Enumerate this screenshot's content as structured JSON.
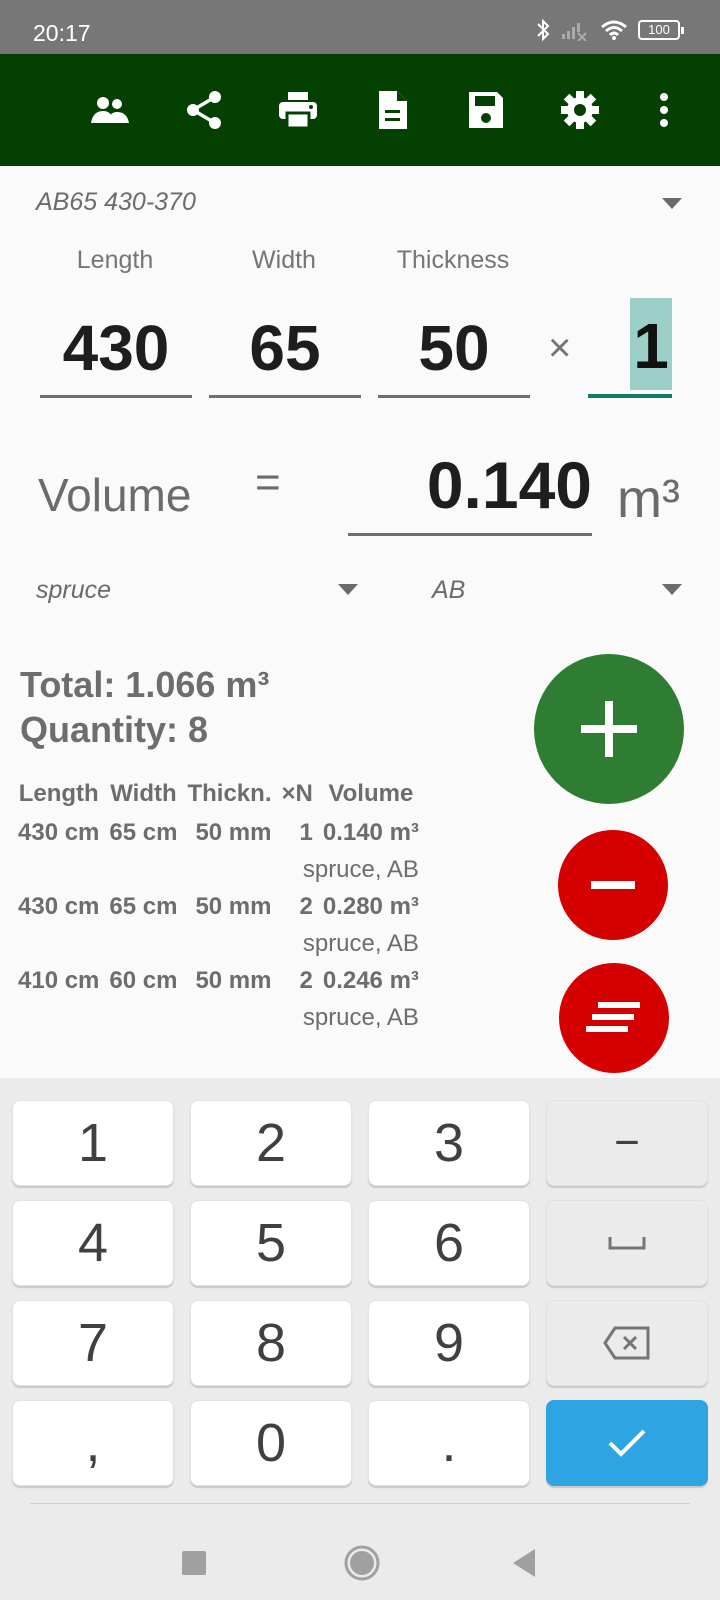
{
  "status_bar": {
    "time": "20:17",
    "battery": "100",
    "icons": [
      "bluetooth-icon",
      "signal-off-icon",
      "wifi-icon",
      "battery-icon"
    ]
  },
  "toolbar": {
    "colors": {
      "background": "#054003",
      "icon": "#ffffff"
    },
    "actions": [
      {
        "name": "customers",
        "icon": "people-icon"
      },
      {
        "name": "share",
        "icon": "share-icon"
      },
      {
        "name": "print",
        "icon": "print-icon"
      },
      {
        "name": "document",
        "icon": "document-icon"
      },
      {
        "name": "save",
        "icon": "save-icon"
      },
      {
        "name": "settings",
        "icon": "gear-icon"
      },
      {
        "name": "more",
        "icon": "more-vert-icon"
      }
    ]
  },
  "form": {
    "preset": "AB65 430-370",
    "labels": {
      "length": "Length",
      "width": "Width",
      "thickness": "Thickness"
    },
    "values": {
      "length": "430",
      "width": "65",
      "thickness": "50",
      "quantity": "1"
    },
    "times_symbol": "×",
    "volume_label": "Volume",
    "equals": "=",
    "volume_value": "0.140",
    "volume_unit": "m³",
    "wood_type": "spruce",
    "grade": "AB"
  },
  "summary": {
    "total": "Total: 1.066 m³",
    "quantity": "Quantity: 8"
  },
  "table": {
    "headers": [
      "Length",
      "Width",
      "Thickn.",
      "×N",
      "Volume"
    ],
    "rows": [
      {
        "length": "430 cm",
        "width": "65 cm",
        "thickness": "50 mm",
        "n": "1",
        "volume": "0.140 m³",
        "sub": "spruce, AB"
      },
      {
        "length": "430 cm",
        "width": "65 cm",
        "thickness": "50 mm",
        "n": "2",
        "volume": "0.280 m³",
        "sub": "spruce, AB"
      },
      {
        "length": "410 cm",
        "width": "60 cm",
        "thickness": "50 mm",
        "n": "2",
        "volume": "0.246 m³",
        "sub": "spruce, AB"
      }
    ]
  },
  "fabs": {
    "add": {
      "icon": "plus-icon",
      "color": "#2e7d32"
    },
    "remove": {
      "icon": "minus-icon",
      "color": "#d50000"
    },
    "list": {
      "icon": "list-icon",
      "color": "#d50000"
    }
  },
  "keyboard": {
    "keys": [
      "1",
      "2",
      "3",
      "−",
      "4",
      "5",
      "6",
      "␣",
      "7",
      "8",
      "9",
      "⌫",
      ",",
      "0",
      ".",
      "✓"
    ],
    "accent": "#2fa4e3"
  }
}
